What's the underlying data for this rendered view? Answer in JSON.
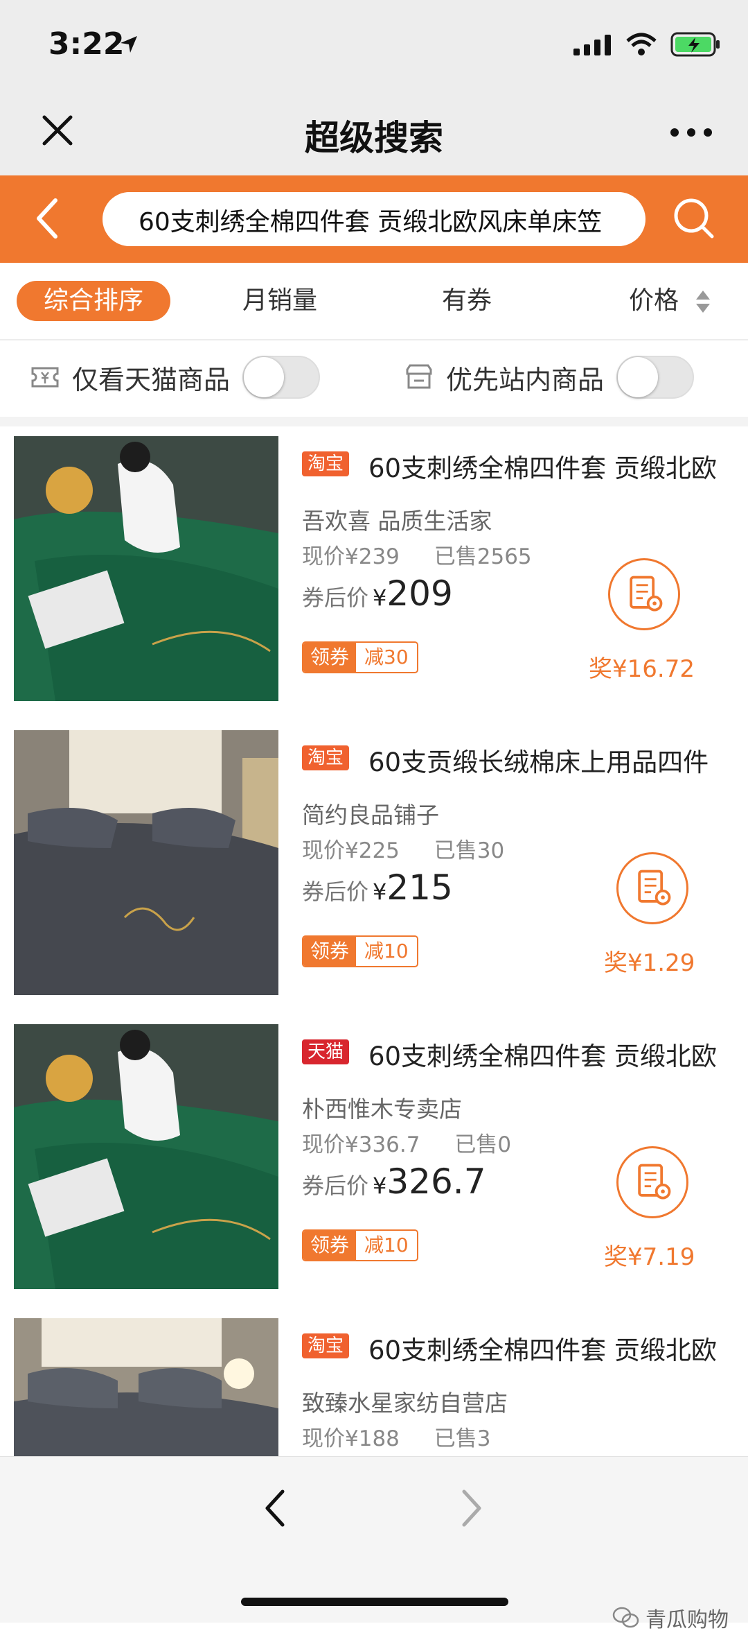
{
  "status_bar": {
    "time": "3:22"
  },
  "nav": {
    "title": "超级搜索"
  },
  "search": {
    "query": "60支刺绣全棉四件套 贡缎北欧风床单床笠"
  },
  "sort": {
    "items": [
      "综合排序",
      "月销量",
      "有券",
      "价格"
    ],
    "active": "综合排序"
  },
  "filters": [
    {
      "label": "仅看天猫商品",
      "icon": "coupon-icon",
      "on": false
    },
    {
      "label": "优先站内商品",
      "icon": "store-icon",
      "on": false
    }
  ],
  "colors": {
    "accent": "#f0782f",
    "taobao": "#f0612f",
    "tmall": "#d8262e"
  },
  "products": [
    {
      "badge": "淘宝",
      "badge_type": "taobao",
      "title": "60支刺绣全棉四件套 贡缎北欧",
      "shop": "吾欢喜 品质生活家",
      "price_label": "现价¥239",
      "sold": "已售2565",
      "after_label": "券后价",
      "after_yen": "¥",
      "after_price": "209",
      "coupon_left": "领券",
      "coupon_right": "减30",
      "rebate": "奖¥16.72",
      "image_color": "green"
    },
    {
      "badge": "淘宝",
      "badge_type": "taobao",
      "title": "60支贡缎长绒棉床上用品四件",
      "shop": "简约良品铺子",
      "price_label": "现价¥225",
      "sold": "已售30",
      "after_label": "券后价",
      "after_yen": "¥",
      "after_price": "215",
      "coupon_left": "领券",
      "coupon_right": "减10",
      "rebate": "奖¥1.29",
      "image_color": "grey"
    },
    {
      "badge": "天猫",
      "badge_type": "tmall",
      "title": "60支刺绣全棉四件套 贡缎北欧",
      "shop": "朴西惟木专卖店",
      "price_label": "现价¥336.7",
      "sold": "已售0",
      "after_label": "券后价",
      "after_yen": "¥",
      "after_price": "326.7",
      "coupon_left": "领券",
      "coupon_right": "减10",
      "rebate": "奖¥7.19",
      "image_color": "green"
    },
    {
      "badge": "淘宝",
      "badge_type": "taobao",
      "title": "60支刺绣全棉四件套 贡缎北欧",
      "shop": "致臻水星家纺自营店",
      "price_label": "现价¥188",
      "sold": "已售3",
      "after_label": "",
      "after_yen": "",
      "after_price": "",
      "coupon_left": "",
      "coupon_right": "",
      "rebate": "",
      "image_color": "grey"
    }
  ],
  "watermark": "青瓜购物"
}
